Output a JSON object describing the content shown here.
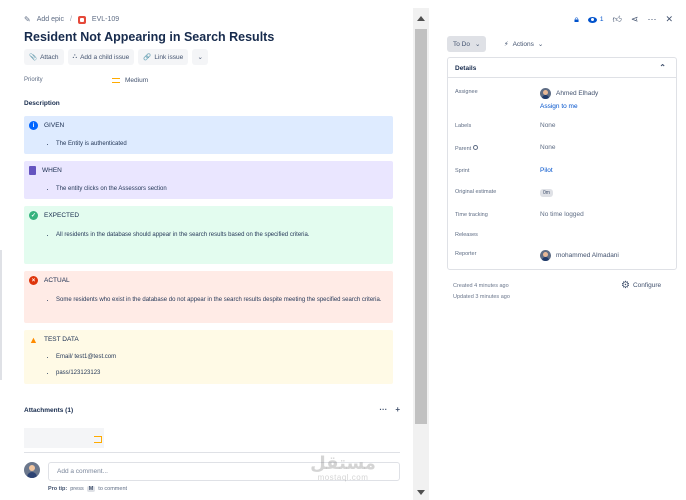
{
  "breadcrumb": {
    "add_epic": "Add epic",
    "separator": "/",
    "issue_key": "EVL-109"
  },
  "issue": {
    "title": "Resident Not Appearing in Search Results"
  },
  "toolbar": {
    "attach": "Attach",
    "add_child": "Add a child issue",
    "link": "Link issue"
  },
  "priority": {
    "label": "Priority",
    "value": "Medium",
    "color": "#FFAB00"
  },
  "description": {
    "label": "Description",
    "panels": [
      {
        "title": "GIVEN",
        "icon": "info-icon",
        "color": "#0065FF",
        "items": [
          "The Entity is authenticated"
        ]
      },
      {
        "title": "WHEN",
        "icon": "note-icon",
        "color": "#6554C0",
        "items": [
          "The entity clicks on the Assessors section"
        ]
      },
      {
        "title": "EXPECTED",
        "icon": "check-icon",
        "color": "#36B37E",
        "items": [
          "All residents in the database should appear in the search results based on the specified criteria."
        ]
      },
      {
        "title": "ACTUAL",
        "icon": "error-icon",
        "color": "#DE350B",
        "items": [
          "Some residents who exist in the database do not appear in the search results despite meeting the specified search criteria."
        ]
      },
      {
        "title": "TEST DATA",
        "icon": "warning-icon",
        "color": "#FF8B00",
        "items": [
          "Email/ test1@test.com",
          "pass/123123123"
        ]
      }
    ]
  },
  "attachments": {
    "label": "Attachments (1)",
    "more": "···",
    "add": "+"
  },
  "comment": {
    "placeholder": "Add a comment...",
    "protip_prefix": "Pro tip:",
    "protip_press": "press",
    "protip_key": "M",
    "protip_suffix": "to comment"
  },
  "header": {
    "watchers": "1"
  },
  "status": {
    "label": "To Do",
    "actions": "Actions"
  },
  "details": {
    "title": "Details",
    "assignee_label": "Assignee",
    "assignee": "Ahmed Elhady",
    "assign_to_me": "Assign to me",
    "labels_label": "Labels",
    "labels": "None",
    "parent_label": "Parent",
    "parent": "None",
    "sprint_label": "Sprint",
    "sprint": "Pilot",
    "estimate_label": "Original estimate",
    "estimate": "0m",
    "tracking_label": "Time tracking",
    "tracking": "No time logged",
    "releases_label": "Releases",
    "reporter_label": "Reporter",
    "reporter": "mohammed Almadani"
  },
  "meta": {
    "created": "Created 4 minutes ago",
    "updated": "Updated 3 minutes ago",
    "configure": "Configure"
  },
  "watermark": {
    "arabic": "مستقل",
    "latin": "mostaql.com"
  }
}
